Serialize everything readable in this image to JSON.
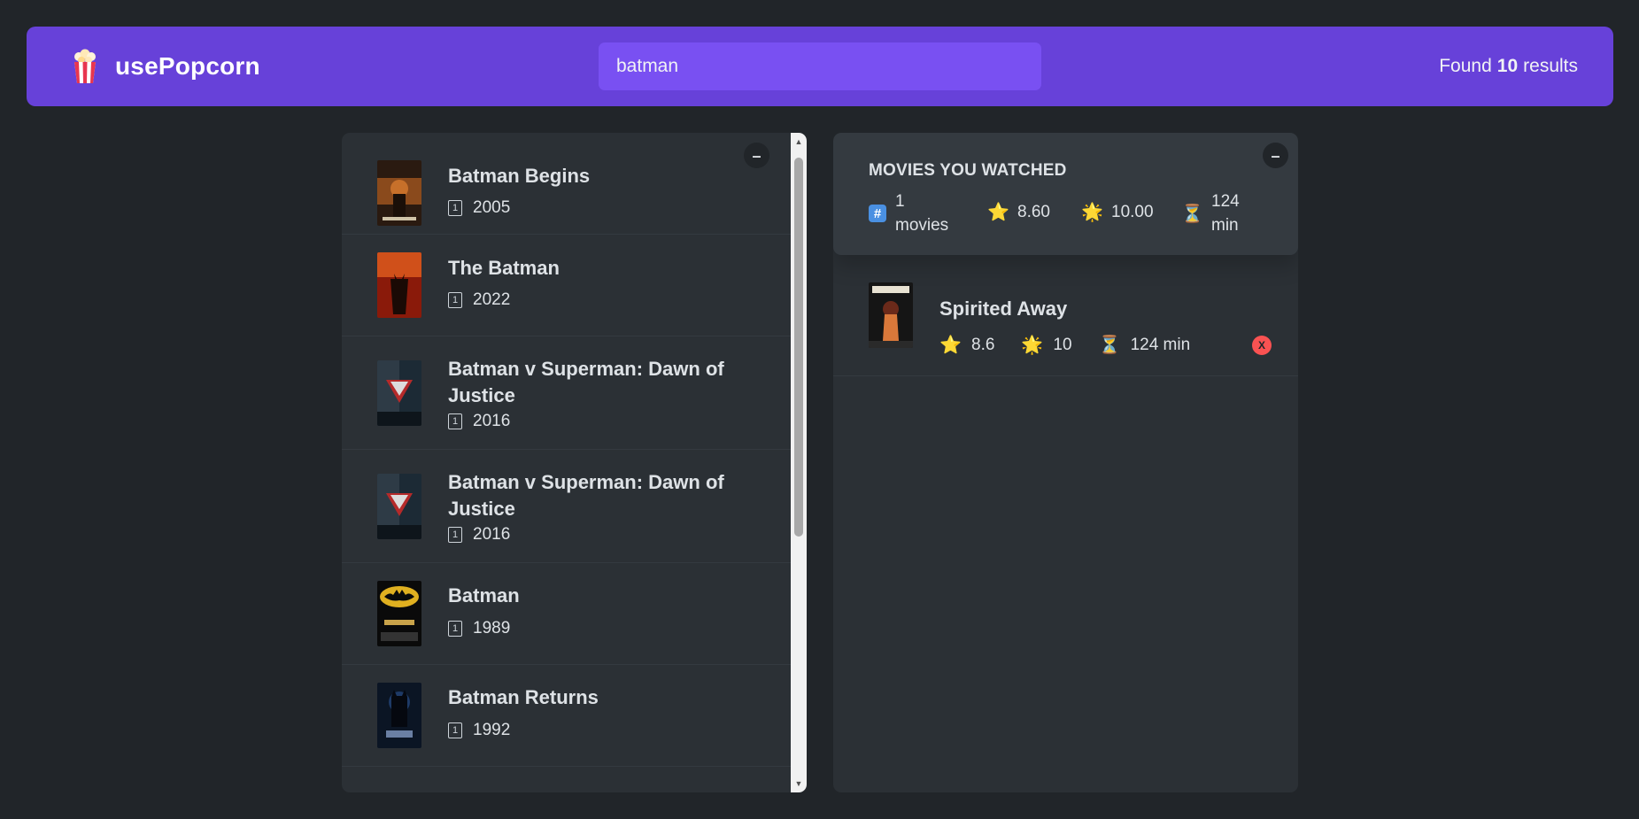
{
  "navbar": {
    "logo_text": "usePopcorn",
    "logo_icon": "popcorn-icon",
    "search_value": "batman",
    "results_prefix": "Found",
    "results_count": "10",
    "results_suffix": "results"
  },
  "movies": [
    {
      "title": "Batman Begins",
      "year": "2005"
    },
    {
      "title": "The Batman",
      "year": "2022"
    },
    {
      "title": "Batman v Superman: Dawn of Justice",
      "year": "2016"
    },
    {
      "title": "Batman v Superman: Dawn of Justice",
      "year": "2016"
    },
    {
      "title": "Batman",
      "year": "1989"
    },
    {
      "title": "Batman Returns",
      "year": "1992"
    }
  ],
  "toggle_label": "–",
  "summary": {
    "heading": "Movies you watched",
    "count_value": "1",
    "count_unit": "movies",
    "imdb_rating": "8.60",
    "user_rating": "10.00",
    "runtime_value": "124",
    "runtime_unit": "min"
  },
  "watched": [
    {
      "title": "Spirited Away",
      "imdb_rating": "8.6",
      "user_rating": "10",
      "runtime": "124 min",
      "delete_label": "X"
    }
  ],
  "colors": {
    "background": "#212529",
    "navbar": "#6741d9",
    "search": "#7950f2",
    "box": "#2b3035",
    "summary": "#343a40",
    "delete": "#fa5252"
  }
}
